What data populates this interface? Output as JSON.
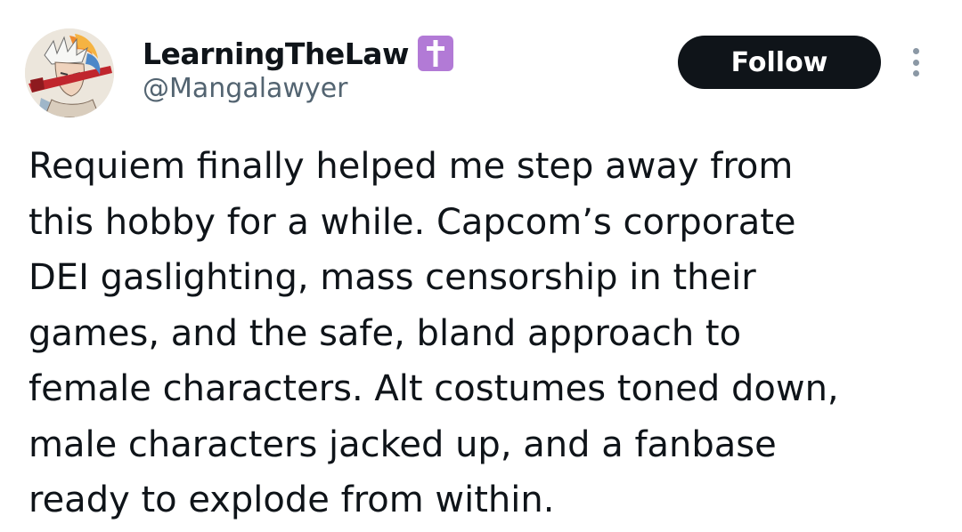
{
  "author": {
    "display_name": "LearningTheLaw",
    "badge_icon": "latin-cross-icon",
    "badge_color": "#b27ad6",
    "handle": "@Mangalawyer"
  },
  "actions": {
    "follow_label": "Follow",
    "more_icon": "vertical-ellipsis-icon"
  },
  "tweet": {
    "lines": [
      "Requiem finally helped me step away from",
      "this hobby for a while. Capcom’s corporate",
      "DEI gaslighting, mass censorship in their",
      "games, and the safe, bland approach to",
      "female characters. Alt costumes toned down,",
      "male characters jacked up, and a fanbase",
      "ready to explode from within."
    ]
  },
  "colors": {
    "text": "#0f1419",
    "secondary_text": "#536471",
    "follow_button_bg": "#0f1419",
    "follow_button_text": "#ffffff",
    "more_dots": "#8b98a5"
  }
}
